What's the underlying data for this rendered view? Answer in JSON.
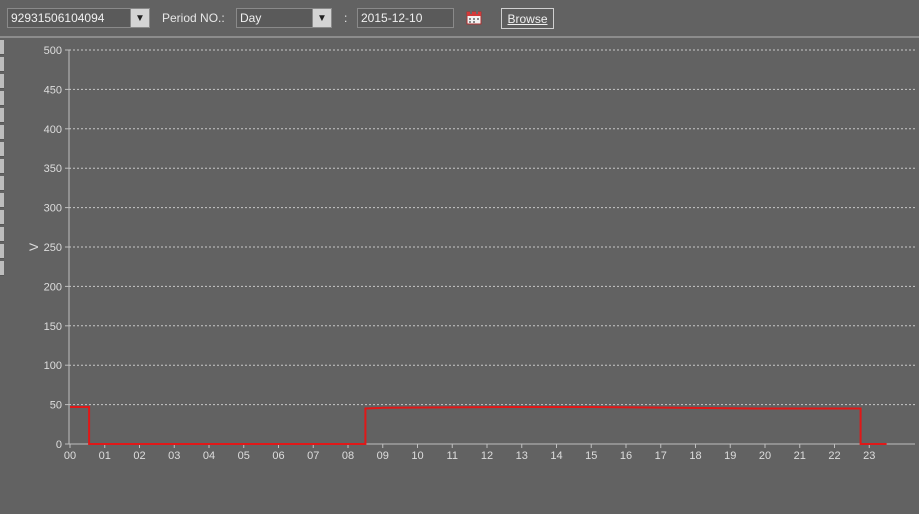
{
  "toolbar": {
    "device_id": "92931506104094",
    "period_label": "Period NO.:",
    "period_value": "Day",
    "colon": ":",
    "date_value": "2015-12-10",
    "calendar_icon": "calendar-icon",
    "browse_label": "Browse"
  },
  "chart_data": {
    "type": "line",
    "ylabel": "V",
    "xlabel": "",
    "ylim": [
      0,
      500
    ],
    "xlim": [
      0,
      23.5
    ],
    "y_ticks": [
      0,
      50,
      100,
      150,
      200,
      250,
      300,
      350,
      400,
      450,
      500
    ],
    "x_ticks": [
      "00",
      "01",
      "02",
      "03",
      "04",
      "05",
      "06",
      "07",
      "08",
      "09",
      "10",
      "11",
      "12",
      "13",
      "14",
      "15",
      "16",
      "17",
      "18",
      "19",
      "20",
      "21",
      "22",
      "23"
    ],
    "grid": true,
    "series": [
      {
        "name": "",
        "color": "#e01818",
        "step": true,
        "points": [
          [
            0,
            47
          ],
          [
            0.55,
            47
          ],
          [
            0.55,
            0
          ],
          [
            8.5,
            0
          ],
          [
            8.5,
            45
          ],
          [
            9.0,
            46
          ],
          [
            12.5,
            47
          ],
          [
            15.0,
            47
          ],
          [
            17.5,
            46
          ],
          [
            19.7,
            45
          ],
          [
            22.75,
            45
          ],
          [
            22.75,
            0
          ],
          [
            23.5,
            0
          ]
        ]
      }
    ]
  }
}
